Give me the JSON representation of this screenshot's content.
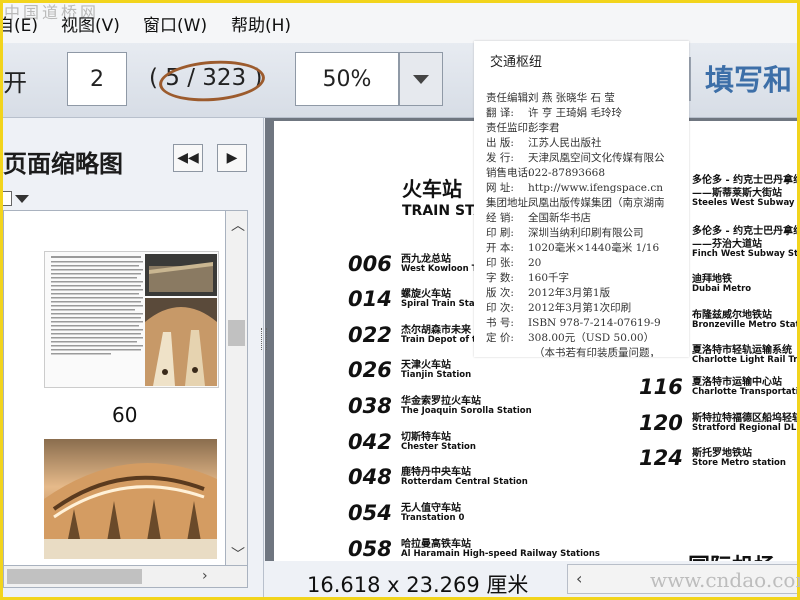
{
  "watermark_top": "中国道桥网",
  "watermark_bottom": "www.cndao.com",
  "menu": {
    "item1": "自(E)",
    "item2": "视图(V)",
    "item3": "窗口(W)",
    "item4": "帮助(H)"
  },
  "toolbar": {
    "open_partial": "开",
    "page_value": "2",
    "page_total": "( 5 / 323 )",
    "zoom_value": "50%",
    "fill_sign_partial": "填写和"
  },
  "left_panel": {
    "title_partial": "页面缩略图",
    "prev_label": "◀◀",
    "next_label": "▶",
    "thumb_page_number": "60"
  },
  "status": {
    "page_size": "16.618 x 23.269 厘米"
  },
  "colophon": {
    "title": "交通枢纽",
    "rows": [
      {
        "label": "责任编辑:",
        "value": "刘 燕  张晓华  石 莹"
      },
      {
        "label": "翻    译:",
        "value": "许 亨  王琦娟  毛玲玲"
      },
      {
        "label": "责任监印:",
        "value": "彭李君"
      },
      {
        "label": "出    版:",
        "value": "江苏人民出版社"
      },
      {
        "label": "发    行:",
        "value": "天津凤凰空间文化传媒有限公"
      },
      {
        "label": "销售电话:",
        "value": "022-87893668"
      },
      {
        "label": "网    址:",
        "value": "http://www.ifengspace.cn"
      },
      {
        "label": "集团地址:",
        "value": "凤凰出版传媒集团（南京湖南"
      },
      {
        "label": "经    销:",
        "value": "全国新华书店"
      },
      {
        "label": "印    刷:",
        "value": "深圳当纳利印刷有限公司"
      },
      {
        "label": "开    本:",
        "value": "1020毫米×1440毫米   1/16"
      },
      {
        "label": "印    张:",
        "value": "20"
      },
      {
        "label": "字    数:",
        "value": "160千字"
      },
      {
        "label": "版    次:",
        "value": "2012年3月第1版"
      },
      {
        "label": "印    次:",
        "value": "2012年3月第1次印刷"
      },
      {
        "label": "书    号:",
        "value": "ISBN 978-7-214-07619-9"
      },
      {
        "label": "定    价:",
        "value": "308.00元（USD 50.00）"
      },
      {
        "label": "",
        "value": "（本书若有印装质量问题，"
      }
    ]
  },
  "document": {
    "heading_cn": "火车站",
    "heading_en": "TRAIN STAT",
    "left_entries": [
      {
        "num": "006",
        "cn": "西九龙总站",
        "en": "West Kowloon Ter"
      },
      {
        "num": "014",
        "cn": "螺旋火车站",
        "en": "Spiral Train Statio"
      },
      {
        "num": "022",
        "cn": "杰尔胡森市未来",
        "en": "Train Depot of the"
      },
      {
        "num": "026",
        "cn": "天津火车站",
        "en": "Tianjin Station"
      },
      {
        "num": "038",
        "cn": "华金索罗拉火车站",
        "en": "The Joaquin Sorolla Station"
      },
      {
        "num": "042",
        "cn": "切斯特车站",
        "en": "Chester Station"
      },
      {
        "num": "048",
        "cn": "鹿特丹中央车站",
        "en": "Rotterdam Central Station"
      },
      {
        "num": "054",
        "cn": "无人值守车站",
        "en": "Transtation 0"
      },
      {
        "num": "058",
        "cn": "哈拉曼高铁车站",
        "en": "Al Haramain High-speed Railway Stations"
      }
    ],
    "right_entries": [
      {
        "cn": "多伦多 - 约克士巴丹拿线",
        "cn2": "——斯蒂莱斯大街站",
        "en": "Steeles West Subway Stat"
      },
      {
        "cn": "多伦多 - 约克士巴丹拿线",
        "cn2": "——芬治大道站",
        "en": "Finch West Subway Statio"
      },
      {
        "cn": "迪拜地铁",
        "cn2": "",
        "en": "Dubai Metro"
      },
      {
        "cn": "布隆兹威尔地铁站",
        "cn2": "",
        "en": "Bronzeville Metro Station"
      },
      {
        "cn": "夏洛特市轻轨运输系统",
        "cn2": "",
        "en": "Charlotte Light Rail Transi"
      }
    ],
    "numbered_right": [
      {
        "num": "116",
        "cn": "夏洛特市运输中心站",
        "en": "Charlotte Transportation C"
      },
      {
        "num": "120",
        "cn": "斯特拉特福德区船坞轻轨",
        "en": "Stratford Regional DLR Sta"
      },
      {
        "num": "124",
        "cn": "斯托罗地铁站",
        "en": "Store Metro station"
      }
    ],
    "airport_heading": "国际机场"
  }
}
